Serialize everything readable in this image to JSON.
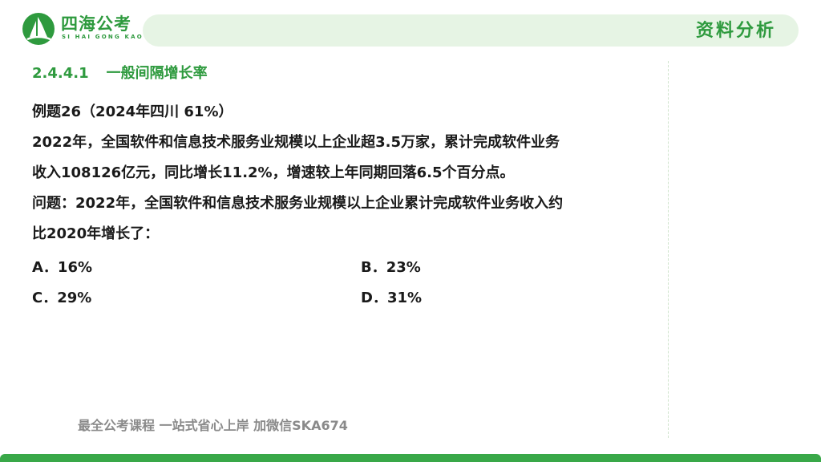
{
  "header": {
    "logo_text": "四海公考",
    "logo_subtext": "SI HAI GONG KAO",
    "section_label": "资料分析"
  },
  "heading": {
    "number": "2.4.4.1",
    "title": "一般间隔增长率"
  },
  "question": {
    "label": "例题26（2024年四川  61%）",
    "body_line1": "2022年，全国软件和信息技术服务业规模以上企业超3.5万家，累计完成软件业务",
    "body_line2": "收入108126亿元，同比增长11.2%，增速较上年同期回落6.5个百分点。",
    "prompt_line1": "问题：2022年，全国软件和信息技术服务业规模以上企业累计完成软件业务收入约",
    "prompt_line2": "比2020年增长了："
  },
  "options": [
    {
      "text": "A．16%"
    },
    {
      "text": "B．23%"
    },
    {
      "text": "C．29%"
    },
    {
      "text": "D．31%"
    }
  ],
  "footer": {
    "ad_text": "最全公考课程 一站式省心上岸 加微信SKA674"
  },
  "colors": {
    "brand_green": "#2e9a3e",
    "header_bar": "#e6f4e4",
    "bottom_bar": "#39a848"
  }
}
